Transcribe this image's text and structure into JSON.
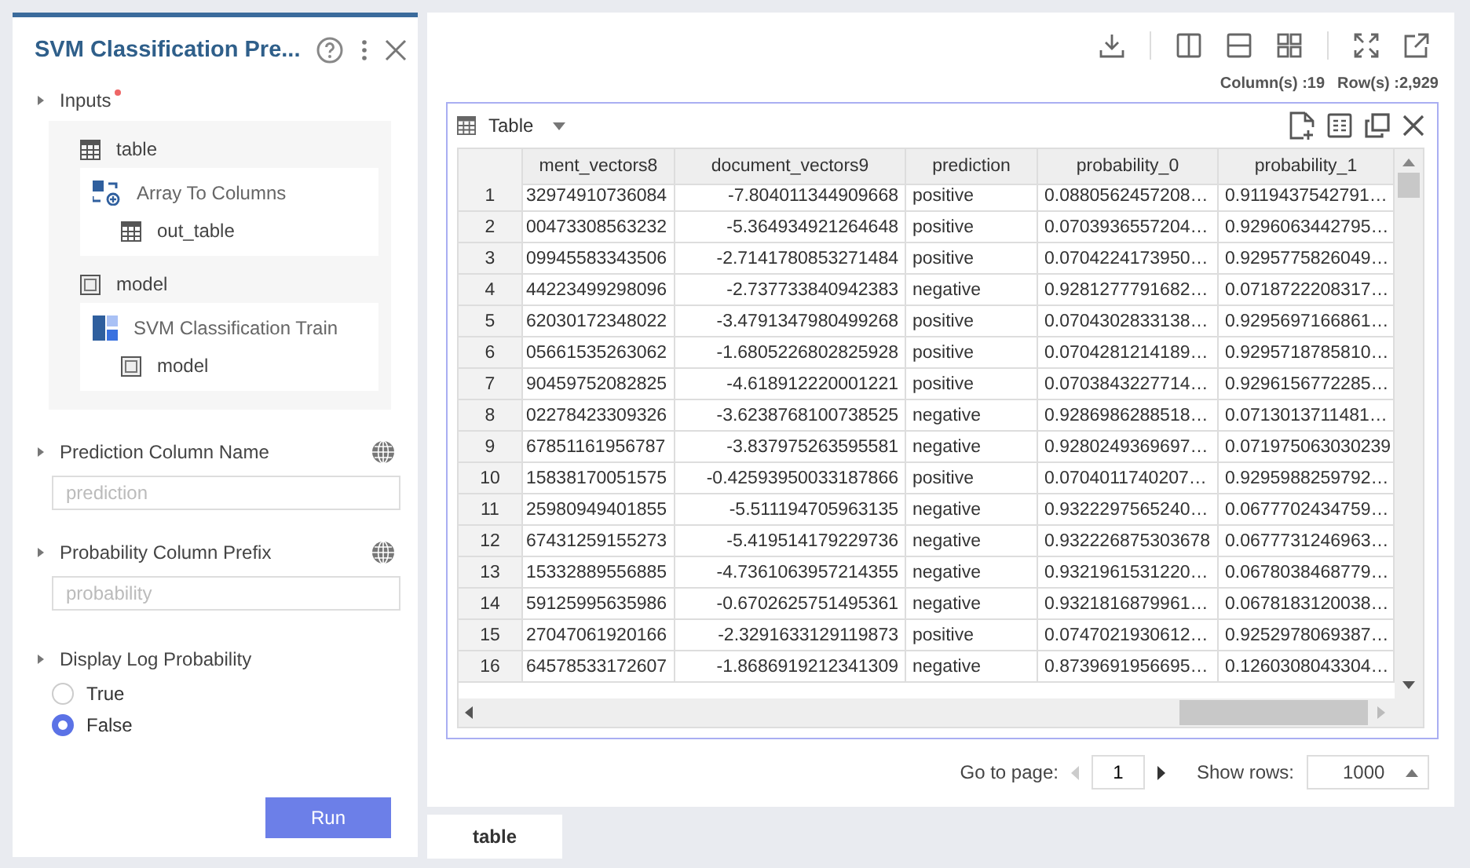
{
  "panel": {
    "title": "SVM Classification Pre...",
    "inputs": {
      "label": "Inputs",
      "required": true,
      "items": [
        {
          "kind": "table",
          "name": "table",
          "source": {
            "kind": "transform",
            "name": "Array To Columns",
            "output": "out_table"
          }
        },
        {
          "kind": "model",
          "name": "model",
          "source": {
            "kind": "train",
            "name": "SVM Classification Train",
            "output": "model"
          }
        }
      ]
    },
    "fields": [
      {
        "label": "Prediction Column Name",
        "placeholder": "prediction"
      },
      {
        "label": "Probability Column Prefix",
        "placeholder": "probability"
      }
    ],
    "log_option": {
      "label": "Display Log Probability",
      "options": [
        {
          "label": "True",
          "selected": false
        },
        {
          "label": "False",
          "selected": true
        }
      ]
    },
    "run_button": "Run"
  },
  "summary": {
    "columns": "Column(s) :19",
    "rows": "Row(s) :2,929"
  },
  "table_view": {
    "title": "Table",
    "columns": [
      "ment_vectors8",
      "document_vectors9",
      "prediction",
      "probability_0",
      "probability_1"
    ],
    "rows": [
      {
        "index": "1",
        "cells": [
          "32974910736084",
          "-7.804011344909668",
          "positive",
          "0.0880562457208…",
          "0.9119437542791…"
        ]
      },
      {
        "index": "2",
        "cells": [
          "00473308563232",
          "-5.364934921264648",
          "positive",
          "0.0703936557204…",
          "0.9296063442795…"
        ]
      },
      {
        "index": "3",
        "cells": [
          "09945583343506",
          "-2.7141780853271484",
          "positive",
          "0.0704224173950…",
          "0.9295775826049…"
        ]
      },
      {
        "index": "4",
        "cells": [
          "44223499298096",
          "-2.737733840942383",
          "negative",
          "0.9281277791682…",
          "0.0718722208317…"
        ]
      },
      {
        "index": "5",
        "cells": [
          "62030172348022",
          "-3.4791347980499268",
          "positive",
          "0.0704302833138…",
          "0.9295697166861…"
        ]
      },
      {
        "index": "6",
        "cells": [
          "05661535263062",
          "-1.6805226802825928",
          "positive",
          "0.0704281214189…",
          "0.9295718785810…"
        ]
      },
      {
        "index": "7",
        "cells": [
          "90459752082825",
          "-4.618912220001221",
          "positive",
          "0.0703843227714…",
          "0.9296156772285…"
        ]
      },
      {
        "index": "8",
        "cells": [
          "02278423309326",
          "-3.6238768100738525",
          "negative",
          "0.9286986288518…",
          "0.0713013711481…"
        ]
      },
      {
        "index": "9",
        "cells": [
          "67851161956787",
          "-3.837975263595581",
          "negative",
          "0.9280249369697…",
          "0.071975063030239"
        ]
      },
      {
        "index": "10",
        "cells": [
          "15838170051575",
          "-0.42593950033187866",
          "positive",
          "0.0704011740207…",
          "0.9295988259792…"
        ]
      },
      {
        "index": "11",
        "cells": [
          "25980949401855",
          "-5.511194705963135",
          "negative",
          "0.9322297565240…",
          "0.0677702434759…"
        ]
      },
      {
        "index": "12",
        "cells": [
          "67431259155273",
          "-5.419514179229736",
          "negative",
          "0.932226875303678",
          "0.0677731246963…"
        ]
      },
      {
        "index": "13",
        "cells": [
          "15332889556885",
          "-4.7361063957214355",
          "negative",
          "0.9321961531220…",
          "0.0678038468779…"
        ]
      },
      {
        "index": "14",
        "cells": [
          "59125995635986",
          "-0.6702625751495361",
          "negative",
          "0.9321816879961…",
          "0.0678183120038…"
        ]
      },
      {
        "index": "15",
        "cells": [
          "27047061920166",
          "-2.3291633129119873",
          "positive",
          "0.0747021930612…",
          "0.9252978069387…"
        ]
      },
      {
        "index": "16",
        "cells": [
          "64578533172607",
          "-1.8686919212341309",
          "negative",
          "0.8739691956695…",
          "0.1260308043304…"
        ]
      }
    ]
  },
  "pagination": {
    "goto_label": "Go to page:",
    "page": "1",
    "rows_label": "Show rows:",
    "rows_value": "1000"
  },
  "bottom_tabs": [
    {
      "label": "table",
      "selected": true
    }
  ]
}
